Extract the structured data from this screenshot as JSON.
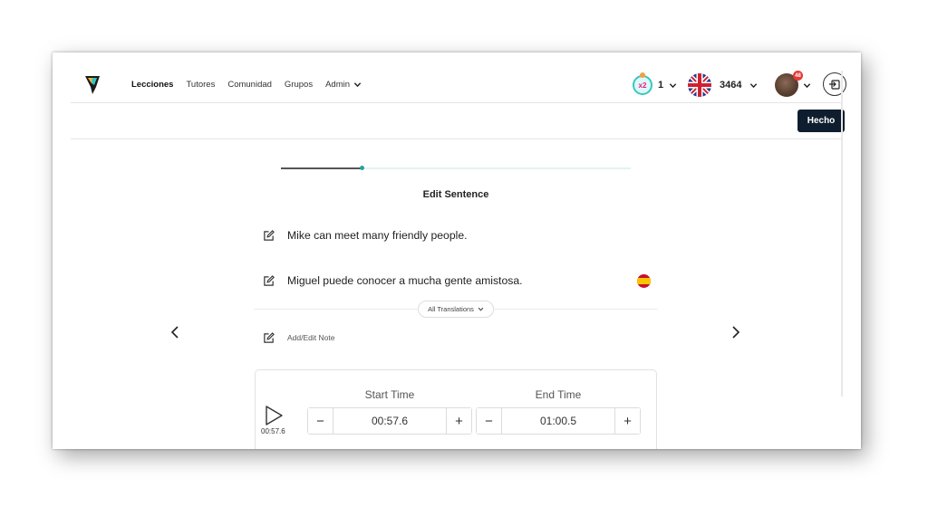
{
  "nav": {
    "links": [
      {
        "label": "Lecciones",
        "active": true
      },
      {
        "label": "Tutores"
      },
      {
        "label": "Comunidad"
      },
      {
        "label": "Grupos"
      },
      {
        "label": "Admin"
      }
    ],
    "multiplier": {
      "badge": "x2",
      "count": "1"
    },
    "score": "3464",
    "notifications": "48"
  },
  "toolbar": {
    "done_label": "Hecho"
  },
  "progress": {
    "fraction": 0.23
  },
  "editor": {
    "title": "Edit Sentence",
    "source_sentence": "Mike can meet many friendly people.",
    "translation": "Miguel puede conocer a mucha gente amistosa.",
    "all_translations_label": "All Translations",
    "note_label": "Add/Edit Note"
  },
  "timing": {
    "play_time": "00:57.6",
    "start_label": "Start Time",
    "start_value": "00:57.6",
    "end_label": "End Time",
    "end_value": "01:00.5",
    "minus_label": "−",
    "plus_label": "+"
  },
  "colors": {
    "accent": "#39c6c1",
    "done_button": "#0f1e2e",
    "progress_dot": "#2aa39a"
  },
  "icons": [
    "app-logo-icon",
    "chevron-down-icon",
    "uk-flag-icon",
    "logout-icon",
    "edit-icon",
    "spain-flag-icon",
    "chevron-left-icon",
    "chevron-right-icon",
    "play-icon"
  ]
}
